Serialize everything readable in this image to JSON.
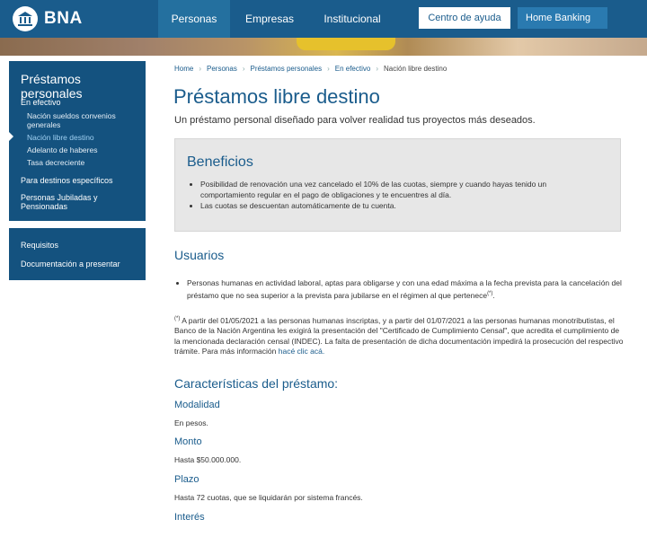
{
  "header": {
    "logo_text": "BNA",
    "nav": [
      "Personas",
      "Empresas",
      "Institucional"
    ],
    "help_button": "Centro de ayuda",
    "home_banking_button": "Home Banking"
  },
  "sidebar": {
    "title": "Préstamos personales",
    "items": [
      {
        "label": "En efectivo"
      },
      {
        "label": "Nación sueldos convenios generales"
      },
      {
        "label": "Nación libre destino"
      },
      {
        "label": "Adelanto de haberes"
      },
      {
        "label": "Tasa decreciente"
      },
      {
        "label": "Para destinos específicos"
      },
      {
        "label": "Personas Jubiladas y Pensionadas"
      }
    ],
    "links": [
      "Requisitos",
      "Documentación a presentar"
    ]
  },
  "breadcrumb": [
    "Home",
    "Personas",
    "Préstamos personales",
    "En efectivo",
    "Nación libre destino"
  ],
  "page": {
    "title": "Préstamos libre destino",
    "subtitle": "Un préstamo personal diseñado para volver realidad tus proyectos más deseados."
  },
  "beneficios": {
    "title": "Beneficios",
    "items": [
      "Posibilidad de renovación una vez cancelado el 10% de las cuotas, siempre y cuando hayas tenido un comportamiento regular en el pago de obligaciones y te encuentres al día.",
      "Las cuotas se descuentan automáticamente de tu cuenta."
    ]
  },
  "usuarios": {
    "title": "Usuarios",
    "item": "Personas humanas en actividad laboral, aptas para obligarse y con una edad máxima a la fecha prevista para la cancelación del préstamo que no sea superior a la prevista para jubilarse en el régimen al que pertenece",
    "item_sup": "(*)",
    "note_sup": "(*)",
    "note": " A partir del 01/05/2021 a las personas humanas inscriptas, y a partir del 01/07/2021 a las personas humanas monotributistas, el Banco de la Nación Argentina les exigirá la presentación del \"Certificado de Cumplimiento Censal\", que acredita el cumplimiento de la mencionada declaración censal (INDEC). La falta de presentación de dicha documentación impedirá la prosecución del respectivo trámite. Para más información ",
    "note_link": "hacé clic acá."
  },
  "caracteristicas": {
    "title": "Características del préstamo:",
    "fields": [
      {
        "label": "Modalidad",
        "value": "En pesos."
      },
      {
        "label": "Monto",
        "value": "Hasta $50.000.000."
      },
      {
        "label": "Plazo",
        "value": "Hasta 72 cuotas, que se liquidarán por sistema francés."
      },
      {
        "label": "Interés",
        "value": ""
      }
    ]
  },
  "colors": {
    "primary": "#1a5c8c",
    "sidebar": "#14527f",
    "active_link": "#9fd0f2",
    "box_bg": "#e7e7e7"
  }
}
